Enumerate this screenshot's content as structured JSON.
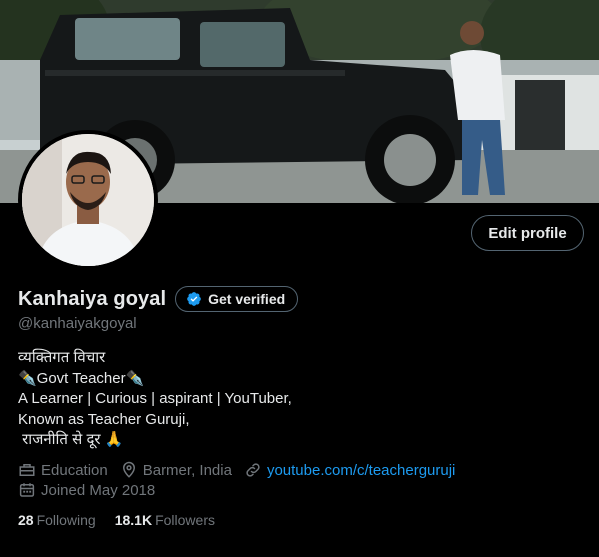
{
  "profile": {
    "display_name": "Kanhaiya goyal",
    "verify_label": "Get verified",
    "handle": "@kanhaiyakgoyal",
    "edit_label": "Edit profile"
  },
  "bio": {
    "lines": [
      "व्यक्तिगत विचार",
      "✒️Govt Teacher✒️",
      "A Learner | Curious | aspirant | YouTuber,",
      "Known as Teacher Guruji,",
      " राजनीति से दूर 🙏"
    ]
  },
  "meta": {
    "category": "Education",
    "location": "Barmer, India",
    "website": "youtube.com/c/teacherguruji",
    "joined": "Joined May 2018"
  },
  "stats": {
    "following_count": "28",
    "following_label": "Following",
    "followers_count": "18.1K",
    "followers_label": "Followers"
  },
  "icons": {
    "verified": "verified-badge-icon",
    "category": "briefcase-icon",
    "location": "map-pin-icon",
    "website": "link-icon",
    "joined": "calendar-icon"
  },
  "colors": {
    "background": "#000000",
    "text_primary": "#e7e9ea",
    "text_secondary": "#71767b",
    "link": "#1d9bf0",
    "border": "#536471"
  }
}
